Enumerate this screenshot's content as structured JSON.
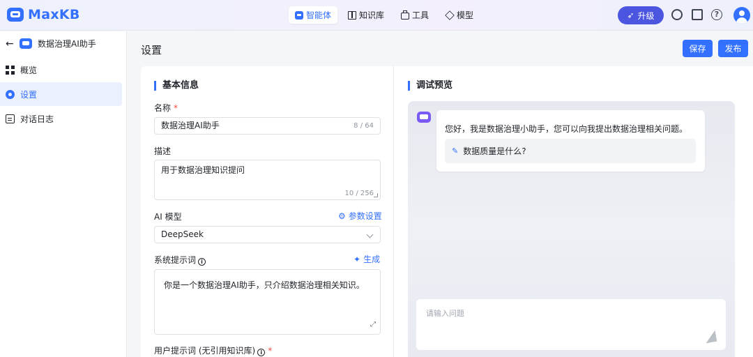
{
  "header": {
    "brand": "MaxKB",
    "nav": [
      {
        "label": "智能体",
        "icon": "robot-icon",
        "active": true
      },
      {
        "label": "知识库",
        "icon": "book-icon",
        "active": false
      },
      {
        "label": "工具",
        "icon": "toolbox-icon",
        "active": false
      },
      {
        "label": "模型",
        "icon": "cube-icon",
        "active": false
      }
    ],
    "upgrade_label": "升级",
    "icons": [
      "github-icon",
      "docs-icon",
      "help-icon",
      "avatar-icon"
    ]
  },
  "sidebar": {
    "app_name": "数据治理AI助手",
    "items": [
      {
        "label": "概览",
        "icon": "grid-icon",
        "active": false
      },
      {
        "label": "设置",
        "icon": "gear-icon",
        "active": true
      },
      {
        "label": "对话日志",
        "icon": "document-icon",
        "active": false
      }
    ]
  },
  "main": {
    "title": "设置",
    "save_label": "保存",
    "publish_label": "发布"
  },
  "basic_info": {
    "section_title": "基本信息",
    "name_label": "名称",
    "required_mark": "*",
    "name_value": "数据治理AI助手",
    "name_counter": "8 / 64",
    "desc_label": "描述",
    "desc_value": "用于数据治理知识提问",
    "desc_counter": "10 / 256",
    "model_label": "AI 模型",
    "model_params_link": "参数设置",
    "model_value": "DeepSeek",
    "system_prompt_label": "系统提示词",
    "generate_link": "生成",
    "system_prompt_value": "你是一个数据治理AI助手，只介绍数据治理相关知识。",
    "user_prompt_label": "用户提示词 (无引用知识库)"
  },
  "debug": {
    "section_title": "调试预览",
    "greeting": "您好，我是数据治理小助手，您可以向我提出数据治理相关问题。",
    "suggestion": "数据质量是什么?",
    "input_placeholder": "请输入问题"
  },
  "colors": {
    "accent": "#3370ff",
    "upgrade": "#4b55e0",
    "bot": "#7a5af8"
  }
}
